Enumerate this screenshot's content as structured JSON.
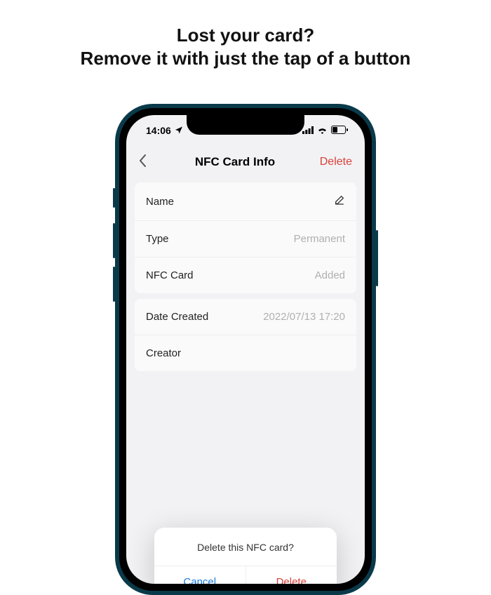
{
  "headline": {
    "line1": "Lost your card?",
    "line2": "Remove it with just the tap of a button"
  },
  "status": {
    "time": "14:06"
  },
  "nav": {
    "title": "NFC Card Info",
    "delete": "Delete"
  },
  "rows": {
    "name": {
      "label": "Name"
    },
    "type": {
      "label": "Type",
      "value": "Permanent"
    },
    "nfc": {
      "label": "NFC Card",
      "value": "Added"
    },
    "date": {
      "label": "Date Created",
      "value": "2022/07/13 17:20"
    },
    "creator": {
      "label": "Creator"
    }
  },
  "dialog": {
    "title": "Delete this NFC card?",
    "cancel": "Cancel",
    "delete": "Delete"
  }
}
